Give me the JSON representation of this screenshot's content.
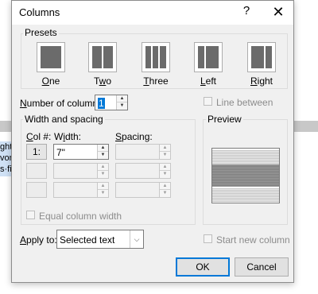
{
  "background": {
    "lines": [
      "ght·",
      "von·",
      "s·fi"
    ]
  },
  "dialog": {
    "title": "Columns",
    "help_glyph": "?",
    "close_glyph": "✕"
  },
  "presets": {
    "label": "Presets",
    "items": [
      {
        "label": "One",
        "accel": "O",
        "rest": "ne"
      },
      {
        "label": "Two",
        "accel": "w",
        "pre": "T",
        "rest": "o"
      },
      {
        "label": "Three",
        "accel": "T",
        "rest": "hree"
      },
      {
        "label": "Left",
        "accel": "L",
        "rest": "eft"
      },
      {
        "label": "Right",
        "accel": "R",
        "rest": "ight"
      }
    ]
  },
  "number_of_columns": {
    "label_accel": "N",
    "label_rest": "umber of columns:",
    "value": "1"
  },
  "line_between": {
    "label": "Line between",
    "checked": false
  },
  "width_spacing": {
    "label": "Width and spacing",
    "col_header_accel": "C",
    "col_header_rest": "ol #:",
    "width_header_pre": "W",
    "width_header_accel": "i",
    "width_header_rest": "dth:",
    "spacing_header_accel": "S",
    "spacing_header_rest": "pacing:",
    "rows": [
      {
        "col": "1:",
        "width": "7\"",
        "spacing": ""
      },
      {
        "col": "",
        "width": "",
        "spacing": ""
      },
      {
        "col": "",
        "width": "",
        "spacing": ""
      }
    ]
  },
  "equal_width": {
    "label": "Equal column width",
    "checked": false
  },
  "preview": {
    "label": "Preview"
  },
  "apply_to": {
    "label_accel": "A",
    "label_rest": "pply to:",
    "value": "Selected text"
  },
  "start_new_column": {
    "label": "Start new column",
    "checked": false
  },
  "buttons": {
    "ok": "OK",
    "cancel": "Cancel"
  }
}
